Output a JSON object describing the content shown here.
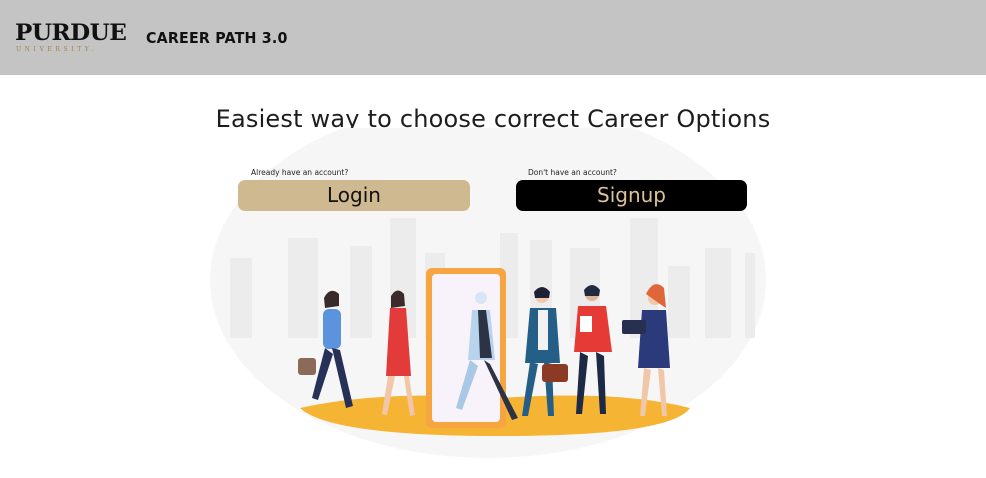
{
  "header": {
    "logo_wordmark": "PURDUE",
    "logo_subtext": "UNIVERSITY.",
    "app_title": "CAREER PATH 3.0"
  },
  "main": {
    "headline": "Easiest way to choose correct Career Options",
    "login": {
      "prompt": "Already have an account?",
      "button_label": "Login"
    },
    "signup": {
      "prompt": "Don't have an account?",
      "button_label": "Signup"
    }
  },
  "colors": {
    "header_bg": "#c4c4c4",
    "purdue_gold": "#cfb991",
    "signup_bg": "#000000",
    "signup_text": "#dcc29a"
  },
  "illustration": {
    "description_icon": "career-door-people-illustration"
  }
}
